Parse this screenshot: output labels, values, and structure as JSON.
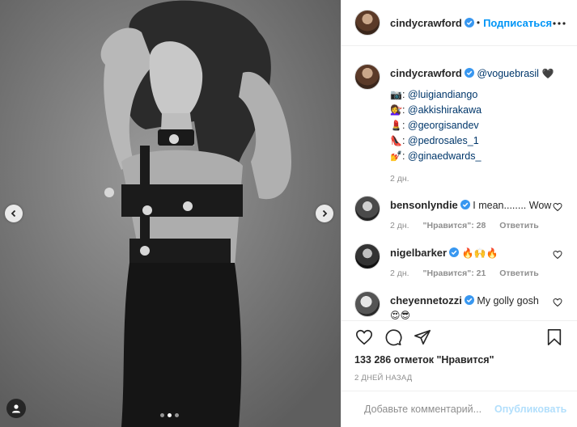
{
  "post": {
    "username": "cindycrawford",
    "follow_label": "Подписаться",
    "caption_mention": "@voguebrasil",
    "caption_heart": "🖤",
    "credits": [
      {
        "emoji": "📷",
        "handle": "@luigiandiango"
      },
      {
        "emoji": "💇‍♀️",
        "handle": "@akkishirakawa"
      },
      {
        "emoji": "💄",
        "handle": "@georgisandev"
      },
      {
        "emoji": "👠",
        "handle": "@pedrosales_1"
      },
      {
        "emoji": "💅",
        "handle": "@ginaedwards_"
      }
    ],
    "caption_time": "2 дн."
  },
  "comments": [
    {
      "user": "bensonlyndie",
      "text": "I mean........ Wow",
      "time": "2 дн.",
      "likes": "\"Нравится\": 28",
      "reply": "Ответить"
    },
    {
      "user": "nigelbarker",
      "text": "🔥🙌🔥",
      "time": "2 дн.",
      "likes": "\"Нравится\": 21",
      "reply": "Ответить"
    },
    {
      "user": "cheyennetozzi",
      "text": "My golly gosh",
      "text2": "😍😎"
    }
  ],
  "likes_text": "133 286 отметок \"Нравится\"",
  "posted_ago": "2 ДНЕЙ НАЗАД",
  "comment_input": {
    "placeholder": "Добавьте комментарий...",
    "publish": "Опубликовать"
  },
  "carousel": {
    "slides": 3,
    "active": 1
  },
  "colors": {
    "accent": "#0095f6",
    "verified": "#3897f0",
    "muted": "#8e8e8e"
  }
}
